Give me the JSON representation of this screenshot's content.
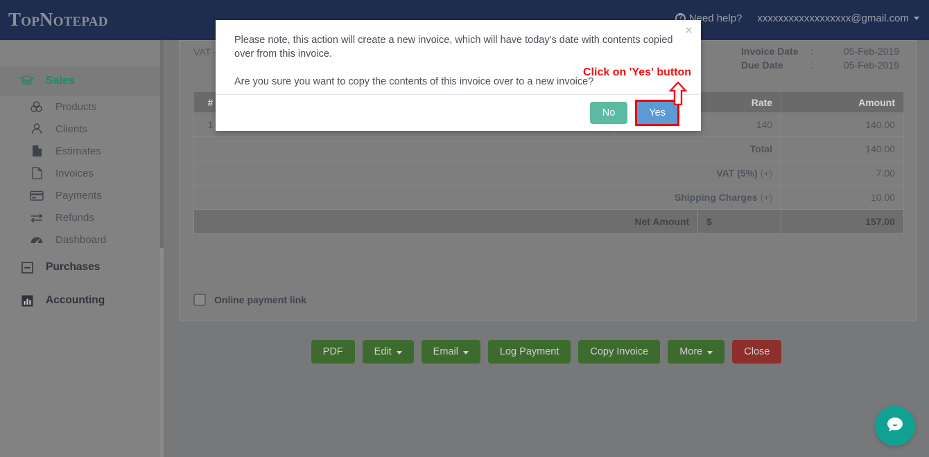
{
  "navbar": {
    "logo": "TopNotepad",
    "need_help": "Need help?",
    "user_email": "xxxxxxxxxxxxxxxxxx@gmail.com",
    "bg_color": "#1e2d4f"
  },
  "sidebar": {
    "group": {
      "label": "Sales",
      "icon": "layers-icon",
      "color": "#1f8a6e"
    },
    "items": [
      {
        "label": "Products",
        "icon": "products-icon"
      },
      {
        "label": "Clients",
        "icon": "user-icon"
      },
      {
        "label": "Estimates",
        "icon": "document-filled-icon"
      },
      {
        "label": "Invoices",
        "icon": "document-outline-icon"
      },
      {
        "label": "Payments",
        "icon": "credit-card-icon"
      },
      {
        "label": "Refunds",
        "icon": "exchange-arrows-icon"
      },
      {
        "label": "Dashboard",
        "icon": "gauge-icon"
      }
    ],
    "sections": [
      {
        "label": "Purchases",
        "icon": "minus-box-icon"
      },
      {
        "label": "Accounting",
        "icon": "bar-chart-icon"
      }
    ]
  },
  "invoice": {
    "vat_line": "VAT -",
    "dates": [
      {
        "label": "Invoice Date",
        "separator": ":",
        "value": "05-Feb-2019"
      },
      {
        "label": "Due Date",
        "separator": ":",
        "value": "05-Feb-2019"
      }
    ],
    "table": {
      "headers": [
        "#",
        "",
        "",
        "Rate",
        "Amount"
      ],
      "rows": [
        {
          "num": "1",
          "description": "",
          "qty": "",
          "rate": "140",
          "amount": "140.00"
        }
      ],
      "totals": [
        {
          "label": "Total",
          "sign": "",
          "currency": "",
          "value": "140.00"
        },
        {
          "label": "VAT (5%)",
          "sign": "(+)",
          "currency": "",
          "value": "7.00"
        },
        {
          "label": "Shipping Charges",
          "sign": "(+)",
          "currency": "",
          "value": "10.00"
        },
        {
          "label": "Net Amount",
          "sign": "",
          "currency": "$",
          "value": "157.00"
        }
      ]
    },
    "online_payment_label": "Online payment link"
  },
  "actions": {
    "buttons": [
      {
        "label": "PDF",
        "caret": false,
        "style": "green"
      },
      {
        "label": "Edit",
        "caret": true,
        "style": "green"
      },
      {
        "label": "Email",
        "caret": true,
        "style": "green"
      },
      {
        "label": "Log Payment",
        "caret": false,
        "style": "green"
      },
      {
        "label": "Copy Invoice",
        "caret": false,
        "style": "green"
      },
      {
        "label": "More",
        "caret": true,
        "style": "green"
      },
      {
        "label": "Close",
        "caret": false,
        "style": "red"
      }
    ],
    "green_color": "#3d6b2e",
    "red_color": "#8f2f2c"
  },
  "modal": {
    "paragraph1": "Please note, this action will create a new invoice, which will have today’s date with contents copied over from this invoice.",
    "paragraph2": "Are you sure you want to copy the contents of this invoice over to a new invoice?",
    "close_label": "×",
    "no_label": "No",
    "yes_label": "Yes",
    "no_color": "#5cb9a2",
    "yes_color": "#5b9bd5"
  },
  "annotation": {
    "text": "Click on 'Yes' button",
    "color": "#ee1111"
  },
  "chat": {
    "icon": "chat-bubble-icon",
    "color": "#11a193"
  }
}
